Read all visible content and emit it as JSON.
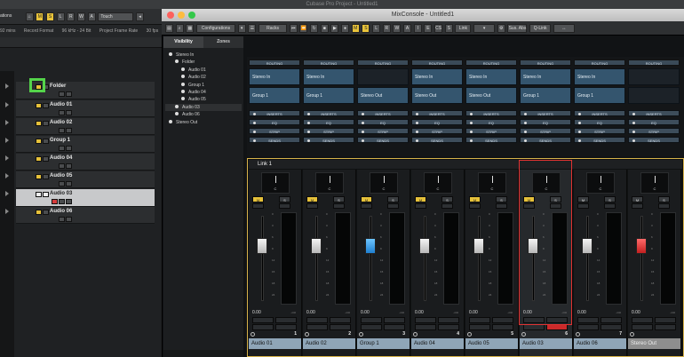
{
  "app_title": "Cubase Pro Project - Untitled1",
  "project_toolbar": {
    "left_label": "ations",
    "buttons": [
      "M",
      "S",
      "L",
      "R",
      "W",
      "A"
    ],
    "automation_mode": "Touch",
    "status": [
      "92 mins",
      "Record Format",
      "96 kHz - 24 Bit",
      "Project Frame Rate",
      "30 fps"
    ]
  },
  "tracks": [
    {
      "name": "Folder",
      "selected": false,
      "expanded": true
    },
    {
      "name": "Audio 01",
      "selected": false
    },
    {
      "name": "Audio 02",
      "selected": false
    },
    {
      "name": "Group 1",
      "selected": false
    },
    {
      "name": "Audio 04",
      "selected": false
    },
    {
      "name": "Audio 05",
      "selected": false
    },
    {
      "name": "Audio 03",
      "selected": true
    },
    {
      "name": "Audio 06",
      "selected": false
    }
  ],
  "mixconsole": {
    "title": "MixConsole - Untitled1",
    "toolbar": {
      "configurations": "Configurations",
      "racks": "Racks",
      "buttons": [
        "M",
        "S",
        "L",
        "R",
        "W",
        "A",
        "I",
        "E",
        "CS",
        "S"
      ],
      "link": "Link",
      "sus_abs": "Sus. Abs",
      "q_link": "Q-Link"
    },
    "tabs": [
      "Visibility",
      "Zones"
    ],
    "visibility_items": [
      {
        "label": "Stereo In",
        "indent": 0,
        "selected": false
      },
      {
        "label": "Folder",
        "indent": 1,
        "selected": false
      },
      {
        "label": "Audio 01",
        "indent": 2,
        "selected": false
      },
      {
        "label": "Audio 02",
        "indent": 2,
        "selected": false
      },
      {
        "label": "Group 1",
        "indent": 2,
        "selected": false
      },
      {
        "label": "Audio 04",
        "indent": 2,
        "selected": false
      },
      {
        "label": "Audio 05",
        "indent": 2,
        "selected": false
      },
      {
        "label": "Audio 03",
        "indent": 1,
        "selected": true
      },
      {
        "label": "Audio 06",
        "indent": 1,
        "selected": false
      },
      {
        "label": "Stereo Out",
        "indent": 0,
        "selected": false
      }
    ],
    "rack_labels": {
      "routing": "ROUTING",
      "inserts": "INSERTS",
      "eq": "EQ",
      "strip": "STRIP",
      "sends": "SENDS"
    },
    "link_label": "Link 1",
    "channels": [
      {
        "name": "Audio 01",
        "input": "Stereo In",
        "output": "Group 1",
        "number": "1",
        "value": "0.00",
        "mute": true,
        "cap": "white",
        "fader": 0.72
      },
      {
        "name": "Audio 02",
        "input": "Stereo In",
        "output": "Group 1",
        "number": "2",
        "value": "0.00",
        "mute": true,
        "cap": "white",
        "fader": 0.72
      },
      {
        "name": "Group 1",
        "input": "",
        "output": "Stereo Out",
        "number": "3",
        "value": "0.00",
        "mute": true,
        "cap": "blue",
        "fader": 0.72
      },
      {
        "name": "Audio 04",
        "input": "Stereo In",
        "output": "Stereo Out",
        "number": "4",
        "value": "0.00",
        "mute": true,
        "cap": "white",
        "fader": 0.72
      },
      {
        "name": "Audio 05",
        "input": "Stereo In",
        "output": "Stereo Out",
        "number": "5",
        "value": "0.00",
        "mute": true,
        "cap": "white",
        "fader": 0.72
      },
      {
        "name": "Audio 03",
        "input": "Stereo In",
        "output": "Group 1",
        "number": "6",
        "value": "0.00",
        "mute": true,
        "cap": "white",
        "fader": 0.72,
        "selected": true
      },
      {
        "name": "Audio 06",
        "input": "Stereo In",
        "output": "Group 1",
        "number": "7",
        "value": "0.00",
        "mute": false,
        "cap": "white",
        "fader": 0.72
      },
      {
        "name": "Stereo Out",
        "input": "",
        "output": "",
        "number": "",
        "value": "0.00",
        "mute": false,
        "cap": "red",
        "fader": 0.72
      }
    ],
    "meter_scale": [
      "0",
      "3",
      "6",
      "9",
      "12",
      "15",
      "18",
      "24"
    ],
    "dash": "-oo",
    "m_label": "M",
    "s_label": "S"
  }
}
